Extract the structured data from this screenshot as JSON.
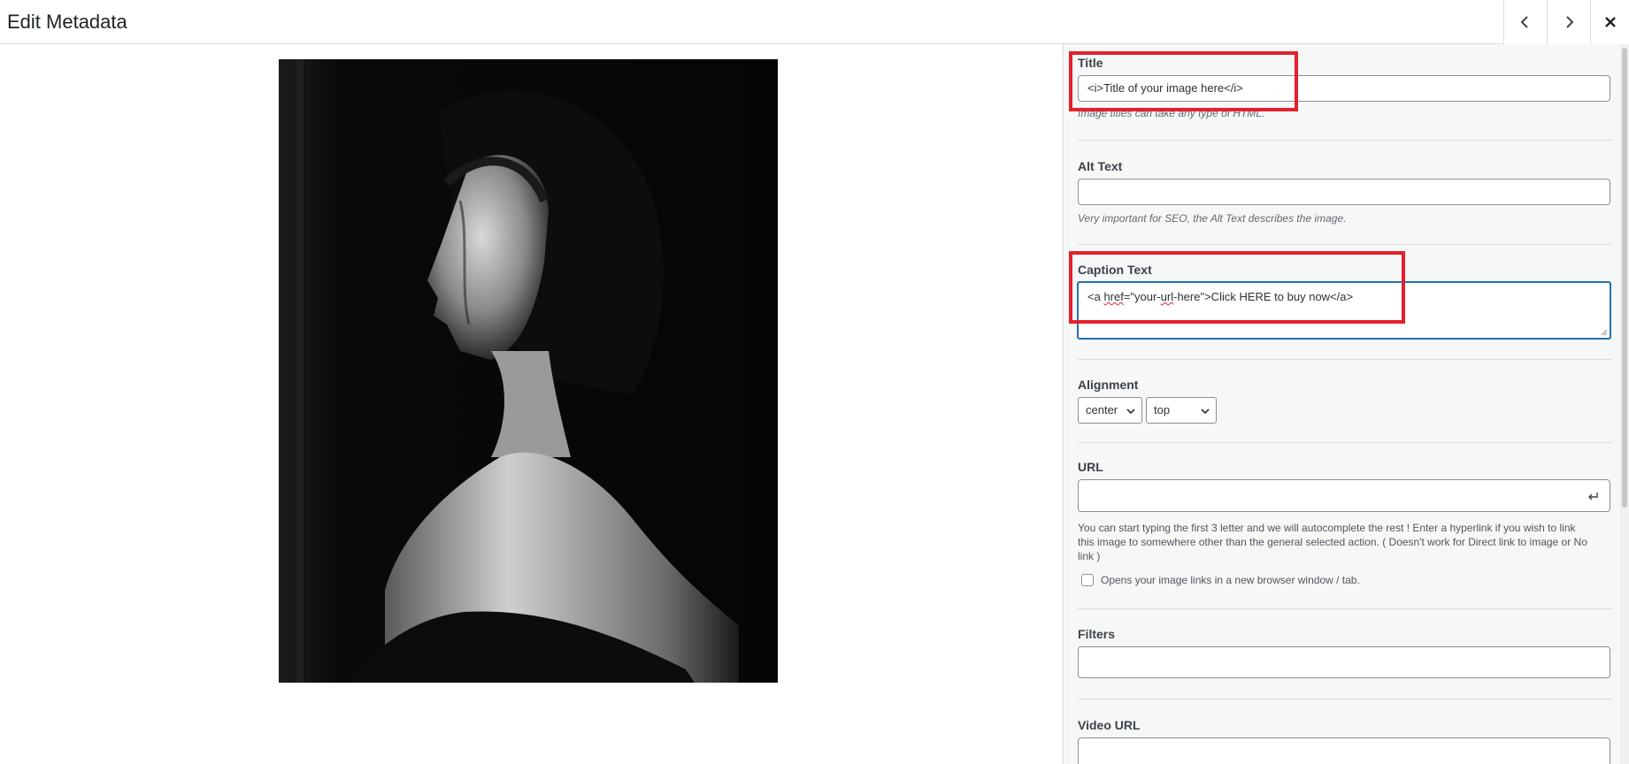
{
  "header": {
    "title": "Edit Metadata",
    "prev_icon": "chevron-left-icon",
    "next_icon": "chevron-right-icon",
    "close_icon": "close-icon"
  },
  "fields": {
    "title": {
      "label": "Title",
      "value": "<i>Title of your image here</i>",
      "help": "Image titles can take any type of HTML."
    },
    "alt_text": {
      "label": "Alt Text",
      "value": "",
      "help": "Very important for SEO, the Alt Text describes the image."
    },
    "caption": {
      "label": "Caption Text",
      "value_prefix": "<a ",
      "value_href_word": "href",
      "value_mid": "=\"your-",
      "value_url_word": "url",
      "value_suffix": "-here\">Click HERE to buy now</a>"
    },
    "alignment": {
      "label": "Alignment",
      "horizontal": "center",
      "vertical": "top"
    },
    "url": {
      "label": "URL",
      "value": "",
      "help": "You can start typing the first 3 letter and we will autocomplete the rest ! Enter a hyperlink if you wish to link this image to somewhere other than the general selected action. ( Doesn't work for Direct link to image or No link )",
      "new_window_label": "Opens your image links in a new browser window / tab.",
      "new_window_checked": false
    },
    "filters": {
      "label": "Filters",
      "value": ""
    },
    "video_url": {
      "label": "Video URL",
      "value": ""
    }
  },
  "colors": {
    "highlight": "#e3212b",
    "focus": "#2271b1",
    "sidebar_bg": "#f6f7f7"
  }
}
